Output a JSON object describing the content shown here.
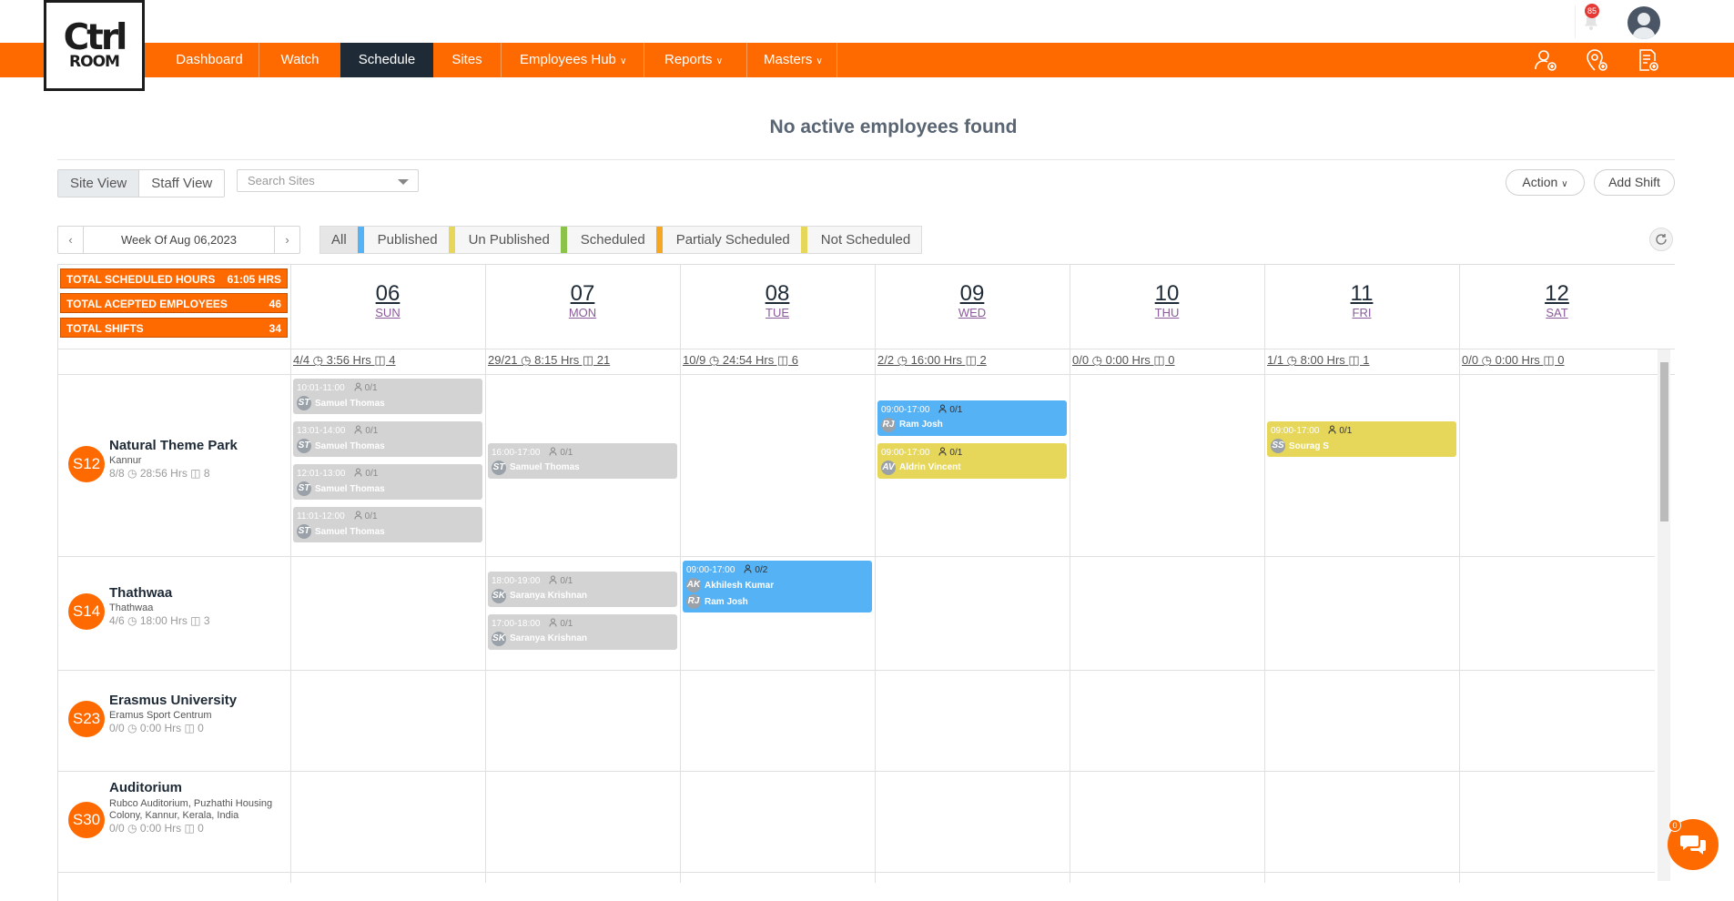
{
  "brand": {
    "line1": "Ctrl",
    "line2": "ROOM"
  },
  "notifications": {
    "count": "85"
  },
  "nav": {
    "items": [
      "Dashboard",
      "Watch",
      "Schedule",
      "Sites",
      "Employees Hub",
      "Reports",
      "Masters"
    ],
    "active": "Schedule"
  },
  "page": {
    "title": "No active employees found"
  },
  "views": {
    "site": "Site View",
    "staff": "Staff View"
  },
  "search": {
    "placeholder": "Search Sites"
  },
  "actions": {
    "action": "Action",
    "add_shift": "Add Shift"
  },
  "week": {
    "label": "Week Of Aug 06,2023",
    "prev": "‹",
    "next": "›"
  },
  "filters": [
    {
      "label": "All",
      "color": ""
    },
    {
      "label": "Published",
      "color": "#55b2f5"
    },
    {
      "label": "Un Published",
      "color": "#e6d75a"
    },
    {
      "label": "Scheduled",
      "color": "#8bc34a"
    },
    {
      "label": "Partialy Scheduled",
      "color": "#f5a623"
    },
    {
      "label": "Not Scheduled",
      "color": "#e6d75a"
    }
  ],
  "totals": [
    {
      "label": "TOTAL SCHEDULED HOURS",
      "value": "61:05 HRS"
    },
    {
      "label": "TOTAL ACEPTED EMPLOYEES",
      "value": "46"
    },
    {
      "label": "TOTAL SHIFTS",
      "value": "34"
    }
  ],
  "days": [
    {
      "date": "06",
      "name": "SUN",
      "summary": "4/4 ◷ 3:56 Hrs ◫ 4"
    },
    {
      "date": "07",
      "name": "MON",
      "summary": "29/21 ◷ 8:15 Hrs ◫ 21"
    },
    {
      "date": "08",
      "name": "TUE",
      "summary": "10/9 ◷ 24:54 Hrs ◫ 6"
    },
    {
      "date": "09",
      "name": "WED",
      "summary": "2/2 ◷ 16:00 Hrs ◫ 2"
    },
    {
      "date": "10",
      "name": "THU",
      "summary": "0/0 ◷ 0:00 Hrs ◫ 0"
    },
    {
      "date": "11",
      "name": "FRI",
      "summary": "1/1 ◷ 8:00 Hrs ◫ 1"
    },
    {
      "date": "12",
      "name": "SAT",
      "summary": "0/0 ◷ 0:00 Hrs ◫ 0"
    }
  ],
  "sites": [
    {
      "code": "S12",
      "name": "Natural Theme Park",
      "sub": "Kannur",
      "stats": "8/8 ◷ 28:56 Hrs ◫ 8"
    },
    {
      "code": "S14",
      "name": "Thathwaa",
      "sub": "Thathwaa",
      "stats": "4/6 ◷ 18:00 Hrs ◫ 3"
    },
    {
      "code": "S23",
      "name": "Erasmus University",
      "sub": "Eramus Sport Centrum",
      "stats": "0/0 ◷ 0:00 Hrs ◫ 0"
    },
    {
      "code": "S30",
      "name": "Auditorium",
      "sub": "Rubco Auditorium, Puzhathi Housing Colony, Kannur, Kerala, India",
      "stats": "0/0 ◷ 0:00 Hrs ◫ 0"
    }
  ],
  "shifts": [
    {
      "site": 0,
      "day": 0,
      "slot": 0,
      "time": "10:01-11:00",
      "count": "0/1",
      "status": "grey",
      "people": [
        {
          "init": "ST",
          "name": "Samuel Thomas"
        }
      ]
    },
    {
      "site": 0,
      "day": 0,
      "slot": 1,
      "time": "13:01-14:00",
      "count": "0/1",
      "status": "grey",
      "people": [
        {
          "init": "ST",
          "name": "Samuel Thomas"
        }
      ]
    },
    {
      "site": 0,
      "day": 0,
      "slot": 2,
      "time": "12:01-13:00",
      "count": "0/1",
      "status": "grey",
      "people": [
        {
          "init": "ST",
          "name": "Samuel Thomas"
        }
      ]
    },
    {
      "site": 0,
      "day": 0,
      "slot": 3,
      "time": "11:01-12:00",
      "count": "0/1",
      "status": "grey",
      "people": [
        {
          "init": "ST",
          "name": "Samuel Thomas"
        }
      ]
    },
    {
      "site": 0,
      "day": 1,
      "slot": 1.5,
      "time": "16:00-17:00",
      "count": "0/1",
      "status": "grey",
      "people": [
        {
          "init": "ST",
          "name": "Samuel Thomas"
        }
      ]
    },
    {
      "site": 0,
      "day": 3,
      "slot": 0.5,
      "time": "09:00-17:00",
      "count": "0/1",
      "status": "blue",
      "people": [
        {
          "init": "RJ",
          "name": "Ram Josh"
        }
      ]
    },
    {
      "site": 0,
      "day": 3,
      "slot": 1.5,
      "time": "09:00-17:00",
      "count": "0/1",
      "status": "yellow",
      "people": [
        {
          "init": "AV",
          "name": "Aldrin Vincent"
        }
      ]
    },
    {
      "site": 0,
      "day": 5,
      "slot": 1,
      "time": "09:00-17:00",
      "count": "0/1",
      "status": "yellow",
      "people": [
        {
          "init": "SS",
          "name": "Sourag S"
        }
      ]
    },
    {
      "site": 1,
      "day": 1,
      "slot": 0.25,
      "time": "18:00-19:00",
      "count": "0/1",
      "status": "grey",
      "people": [
        {
          "init": "SK",
          "name": "Saranya Krishnan"
        }
      ]
    },
    {
      "site": 1,
      "day": 1,
      "slot": 1.25,
      "time": "17:00-18:00",
      "count": "0/1",
      "status": "grey",
      "people": [
        {
          "init": "SK",
          "name": "Saranya Krishnan"
        }
      ]
    },
    {
      "site": 1,
      "day": 2,
      "slot": 0,
      "time": "09:00-17:00",
      "count": "0/2",
      "status": "blue",
      "people": [
        {
          "init": "AK",
          "name": "Akhilesh Kumar"
        },
        {
          "init": "RJ",
          "name": "Ram Josh"
        }
      ]
    }
  ],
  "chat": {
    "count": "0"
  },
  "colors": {
    "accent": "#ff6a00",
    "nav_active": "#1e2a36",
    "published": "#55b2f5",
    "unpublished": "#e6d75a",
    "grey_shift": "#d3d3d3"
  }
}
